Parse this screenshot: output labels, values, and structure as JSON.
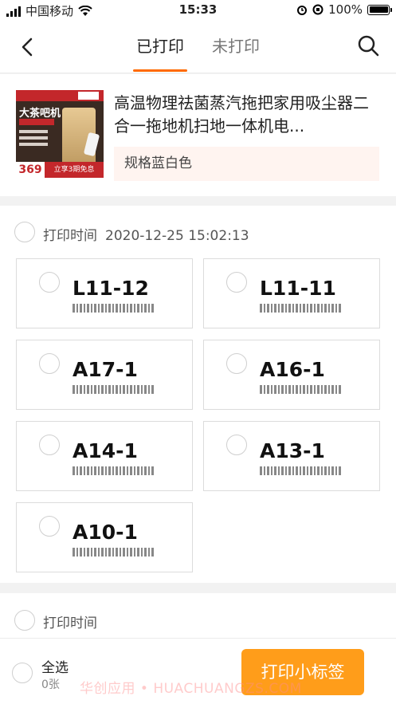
{
  "status_bar": {
    "carrier": "中国移动",
    "time": "15:33",
    "battery": "100%"
  },
  "nav": {
    "tabs": [
      {
        "label": "已打印",
        "active": true
      },
      {
        "label": "未打印",
        "active": false
      }
    ],
    "accent": "#ff6a00",
    "icons": {
      "back": "chevron-left-icon",
      "search": "search-icon"
    }
  },
  "product": {
    "title": "高温物理祛菌蒸汽拖把家用吸尘器二合一拖地机扫地一体机电...",
    "spec": "规格蓝白色",
    "image": {
      "headline": "大茶吧机",
      "price": "369",
      "promo": "立享3期免息"
    }
  },
  "groups": [
    {
      "header_label": "打印时间",
      "timestamp": "2020-12-25 15:02:13",
      "items": [
        "L11-12",
        "L11-11",
        "A17-1",
        "A16-1",
        "A14-1",
        "A13-1",
        "A10-1"
      ]
    },
    {
      "header_label": "打印时间",
      "timestamp": "",
      "items": []
    }
  ],
  "footer": {
    "select_all": "全选",
    "count": "0张",
    "print_button": "打印小标签",
    "button_color": "#ff9d1a"
  },
  "watermark": "华创应用 • HUACHUANGZS.COM"
}
